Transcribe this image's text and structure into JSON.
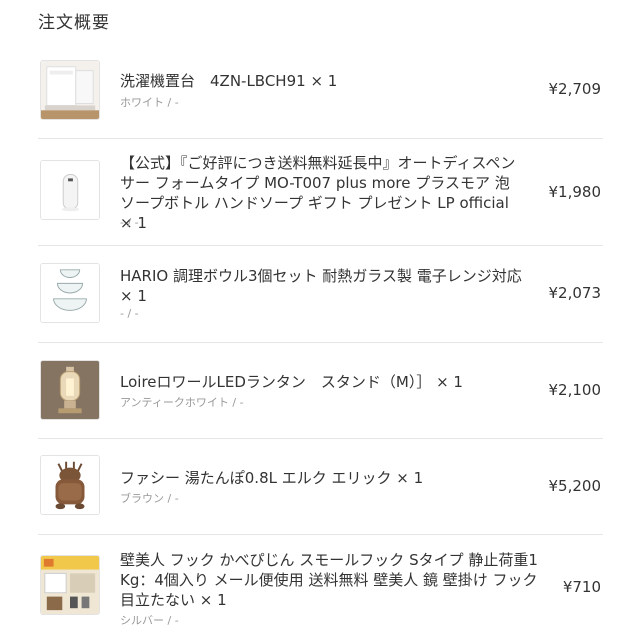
{
  "header": {
    "title": "注文概要"
  },
  "items": [
    {
      "name": "洗濯機置台　4ZN-LBCH91 × 1",
      "variant": "ホワイト / -",
      "price": "¥2,709",
      "icon": "washing-machine-stand"
    },
    {
      "name": "【公式】『ご好評につき送料無料延長中』オートディスペンサー フォームタイプ MO-T007 plus more プラスモア 泡 ソープボトル ハンドソープ ギフト プレゼント LP official × 1",
      "variant": "- / -",
      "price": "¥1,980",
      "icon": "soap-dispenser"
    },
    {
      "name": "HARIO 調理ボウル3個セット 耐熱ガラス製 電子レンジ対応 × 1",
      "variant": "- / -",
      "price": "¥2,073",
      "icon": "glass-bowls"
    },
    {
      "name": "LoireロワールLEDランタン　スタンド（M）］ × 1",
      "variant": "アンティークホワイト / -",
      "price": "¥2,100",
      "icon": "lantern"
    },
    {
      "name": "ファシー 湯たんぽ0.8L エルク エリック × 1",
      "variant": "ブラウン / -",
      "price": "¥5,200",
      "icon": "hot-water-bottle-elk"
    },
    {
      "name": "壁美人 フック かべぴじん スモールフック Sタイプ 静止荷重1 Kg：4個入り メール便使用 送料無料 壁美人 鏡 壁掛け フック 目立たない × 1",
      "variant": "シルバー / -",
      "price": "¥710",
      "icon": "wall-hook"
    }
  ]
}
